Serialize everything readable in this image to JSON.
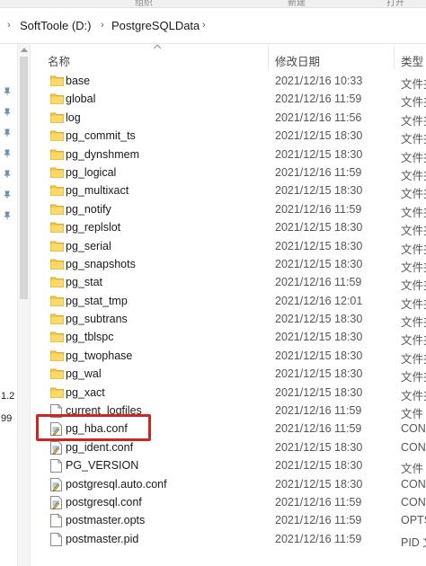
{
  "ribbon": {
    "left_label": "组织",
    "mid_label": "新建",
    "right_label": "打开"
  },
  "address": {
    "crumbs": [
      "SoftToole (D:)",
      "PostgreSQLData"
    ]
  },
  "columns": {
    "name": "名称",
    "date": "修改日期",
    "type": "类型"
  },
  "nav_snippets": [
    "1.2",
    "99"
  ],
  "files": [
    {
      "name": "base",
      "date": "2021/12/16 10:33",
      "type": "文件夹",
      "kind": "folder"
    },
    {
      "name": "global",
      "date": "2021/12/16 11:59",
      "type": "文件夹",
      "kind": "folder"
    },
    {
      "name": "log",
      "date": "2021/12/16 11:56",
      "type": "文件夹",
      "kind": "folder"
    },
    {
      "name": "pg_commit_ts",
      "date": "2021/12/15 18:30",
      "type": "文件夹",
      "kind": "folder"
    },
    {
      "name": "pg_dynshmem",
      "date": "2021/12/15 18:30",
      "type": "文件夹",
      "kind": "folder"
    },
    {
      "name": "pg_logical",
      "date": "2021/12/16 11:59",
      "type": "文件夹",
      "kind": "folder"
    },
    {
      "name": "pg_multixact",
      "date": "2021/12/15 18:30",
      "type": "文件夹",
      "kind": "folder"
    },
    {
      "name": "pg_notify",
      "date": "2021/12/16 11:59",
      "type": "文件夹",
      "kind": "folder"
    },
    {
      "name": "pg_replslot",
      "date": "2021/12/15 18:30",
      "type": "文件夹",
      "kind": "folder"
    },
    {
      "name": "pg_serial",
      "date": "2021/12/15 18:30",
      "type": "文件夹",
      "kind": "folder"
    },
    {
      "name": "pg_snapshots",
      "date": "2021/12/15 18:30",
      "type": "文件夹",
      "kind": "folder"
    },
    {
      "name": "pg_stat",
      "date": "2021/12/16 11:59",
      "type": "文件夹",
      "kind": "folder"
    },
    {
      "name": "pg_stat_tmp",
      "date": "2021/12/16 12:01",
      "type": "文件夹",
      "kind": "folder"
    },
    {
      "name": "pg_subtrans",
      "date": "2021/12/15 18:30",
      "type": "文件夹",
      "kind": "folder"
    },
    {
      "name": "pg_tblspc",
      "date": "2021/12/15 18:30",
      "type": "文件夹",
      "kind": "folder"
    },
    {
      "name": "pg_twophase",
      "date": "2021/12/15 18:30",
      "type": "文件夹",
      "kind": "folder"
    },
    {
      "name": "pg_wal",
      "date": "2021/12/15 18:30",
      "type": "文件夹",
      "kind": "folder"
    },
    {
      "name": "pg_xact",
      "date": "2021/12/15 18:30",
      "type": "文件夹",
      "kind": "folder"
    },
    {
      "name": "current_logfiles",
      "date": "2021/12/16 11:59",
      "type": "文件",
      "kind": "file"
    },
    {
      "name": "pg_hba.conf",
      "date": "2021/12/16 11:59",
      "type": "CON",
      "kind": "conf"
    },
    {
      "name": "pg_ident.conf",
      "date": "2021/12/15 18:30",
      "type": "CON",
      "kind": "conf"
    },
    {
      "name": "PG_VERSION",
      "date": "2021/12/15 18:30",
      "type": "文件",
      "kind": "file"
    },
    {
      "name": "postgresql.auto.conf",
      "date": "2021/12/15 18:30",
      "type": "CON",
      "kind": "conf"
    },
    {
      "name": "postgresql.conf",
      "date": "2021/12/16 11:59",
      "type": "CON",
      "kind": "conf"
    },
    {
      "name": "postmaster.opts",
      "date": "2021/12/16 11:59",
      "type": "OPTS",
      "kind": "file"
    },
    {
      "name": "postmaster.pid",
      "date": "2021/12/16 11:59",
      "type": "PID 文",
      "kind": "file"
    }
  ],
  "colors": {
    "folder": "#f6c94a",
    "folder_dark": "#e1a82a",
    "highlight": "#d32424"
  }
}
